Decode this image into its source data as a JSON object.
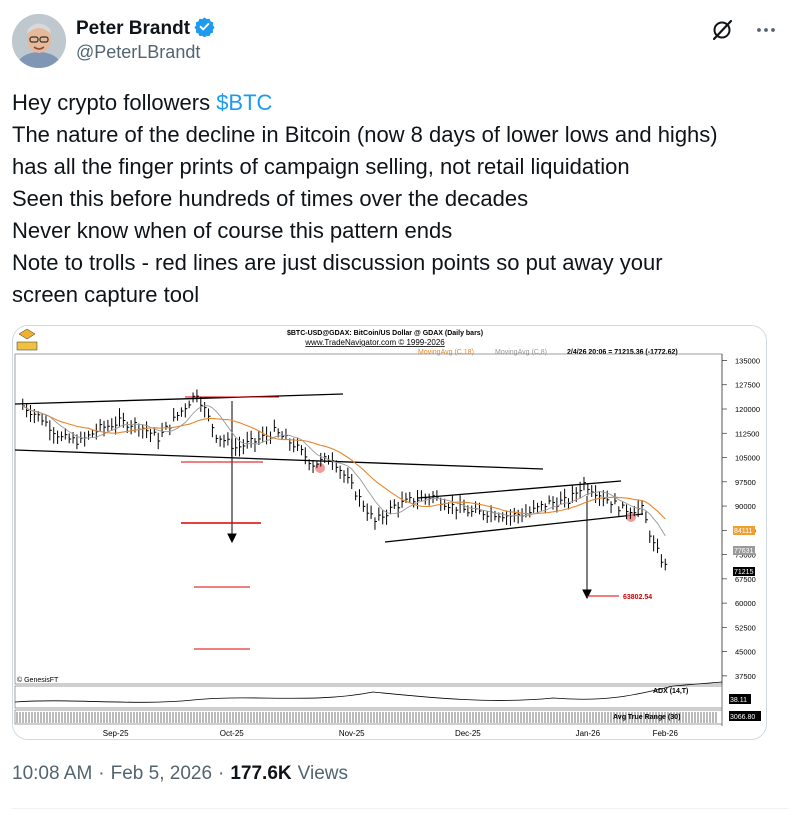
{
  "author": {
    "name": "Peter Brandt",
    "handle": "@PeterLBrandt",
    "verified": true,
    "verified_color": "#1d9bf0"
  },
  "icons": {
    "grok": "grok-icon",
    "more": "more-icon"
  },
  "tweet": {
    "line1_prefix": "Hey crypto followers ",
    "cashtag": "$BTC",
    "lines": [
      "The nature of the decline in Bitcoin (now 8 days of lower lows and highs)",
      "has all the finger prints of campaign selling, not retail liquidation",
      "Seen this before hundreds of times over the decades",
      "Never know when of course this pattern ends",
      "Note to trolls - red lines are just discussion points so put away your",
      "screen capture tool"
    ]
  },
  "chart": {
    "title": "$BTC-USD@GDAX:  BitCoin/US Dollar @ GDAX  (Daily bars)",
    "site": "www.TradeNavigator.com © 1999-2026",
    "ma1_label": "MovingAvg (C,18)",
    "ma2_label": "MovingAvg (C,8)",
    "readout": "2/4/26 20:06 = 71215.36 (-1772.62)",
    "copyright": "© GenesisFT",
    "target_label": "63802.54",
    "adx_label": "ADX (14,T)",
    "adx_value": "38.11",
    "atr_label": "Avg True Range (30)",
    "atr_value": "3066.80",
    "price_tags": [
      "84111",
      "77631",
      "71215"
    ],
    "colors": {
      "price": "#000000",
      "ma18": "#e8862a",
      "ma8": "#999999",
      "red_lines": "#e00000",
      "tag_orange": "#f0a030",
      "tag_gray": "#9a9a9a",
      "tag_black": "#000000"
    }
  },
  "chart_data": {
    "type": "line",
    "title": "$BTC-USD@GDAX:  BitCoin/US Dollar @ GDAX  (Daily bars)",
    "xlabel": "",
    "ylabel": "",
    "ylim": [
      35000,
      137000
    ],
    "x_ticks": [
      "Sep-25",
      "Oct-25",
      "Nov-25",
      "Dec-25",
      "Jan-26",
      "Feb-26"
    ],
    "y_ticks": [
      135000,
      127500,
      120000,
      112500,
      105000,
      97500,
      90000,
      82500,
      75000,
      67500,
      60000,
      52500,
      45000,
      37500
    ],
    "x": [
      "2025-08-22",
      "2025-08-27",
      "2025-09-01",
      "2025-09-06",
      "2025-09-11",
      "2025-09-16",
      "2025-09-21",
      "2025-09-26",
      "2025-10-01",
      "2025-10-06",
      "2025-10-11",
      "2025-10-16",
      "2025-10-21",
      "2025-10-26",
      "2025-10-31",
      "2025-11-05",
      "2025-11-10",
      "2025-11-15",
      "2025-11-21",
      "2025-11-26",
      "2025-12-01",
      "2025-12-06",
      "2025-12-11",
      "2025-12-16",
      "2025-12-21",
      "2025-12-26",
      "2025-12-31",
      "2026-01-05",
      "2026-01-10",
      "2026-01-14",
      "2026-01-19",
      "2026-01-24",
      "2026-01-29",
      "2026-02-01",
      "2026-02-04"
    ],
    "series": [
      {
        "values": [
          121000,
          117000,
          111000,
          110000,
          114000,
          116000,
          115000,
          111000,
          118000,
          125000,
          112000,
          108000,
          110000,
          113000,
          109000,
          103000,
          105000,
          96000,
          85000,
          90000,
          92000,
          93000,
          90000,
          88000,
          88000,
          87000,
          88000,
          91000,
          91500,
          97000,
          93000,
          89000,
          89000,
          78000,
          71215
        ]
      }
    ],
    "annotations": [
      {
        "text": "63802.54",
        "type": "target"
      }
    ],
    "grid": false,
    "legend": "top"
  },
  "footer": {
    "time": "10:08 AM",
    "date": "Feb 5, 2026",
    "separator": "·",
    "views_count": "177.6K",
    "views_label": "Views"
  }
}
